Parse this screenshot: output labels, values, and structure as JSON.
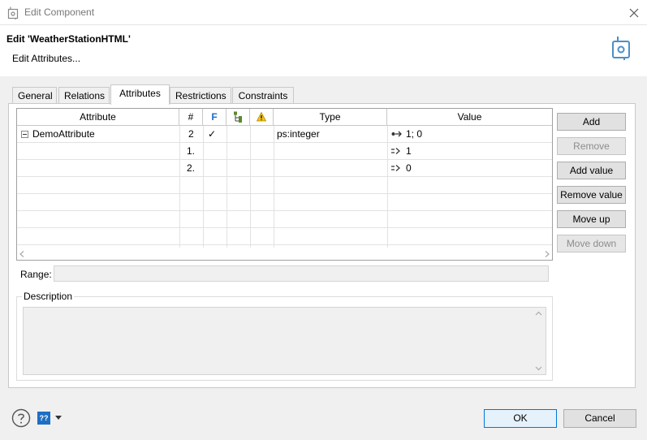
{
  "window": {
    "title": "Edit Component"
  },
  "header": {
    "title": "Edit 'WeatherStationHTML'",
    "subtitle": "Edit Attributes..."
  },
  "tabs": [
    {
      "label": "General"
    },
    {
      "label": "Relations"
    },
    {
      "label": "Attributes"
    },
    {
      "label": "Restrictions"
    },
    {
      "label": "Constraints"
    }
  ],
  "table": {
    "columns": [
      "Attribute",
      "#",
      "F",
      "",
      "",
      "Type",
      "Value"
    ],
    "rows": [
      {
        "attribute": "DemoAttribute",
        "num": "2",
        "check": "✓",
        "type": "ps:integer",
        "value": "1; 0"
      },
      {
        "attribute": "",
        "num": "1.",
        "check": "",
        "type": "",
        "value": "1"
      },
      {
        "attribute": "",
        "num": "2.",
        "check": "",
        "type": "",
        "value": "0"
      }
    ]
  },
  "side_buttons": {
    "add": "Add",
    "remove": "Remove",
    "add_value": "Add value",
    "remove_value": "Remove value",
    "move_up": "Move up",
    "move_down": "Move down"
  },
  "range": {
    "label": "Range:",
    "value": ""
  },
  "description": {
    "label": "Description",
    "value": ""
  },
  "footer": {
    "ok": "OK",
    "cancel": "Cancel",
    "lang_badge": "??"
  },
  "colors": {
    "accent": "#0078d7",
    "lang_badge": "#1e6fc4"
  }
}
